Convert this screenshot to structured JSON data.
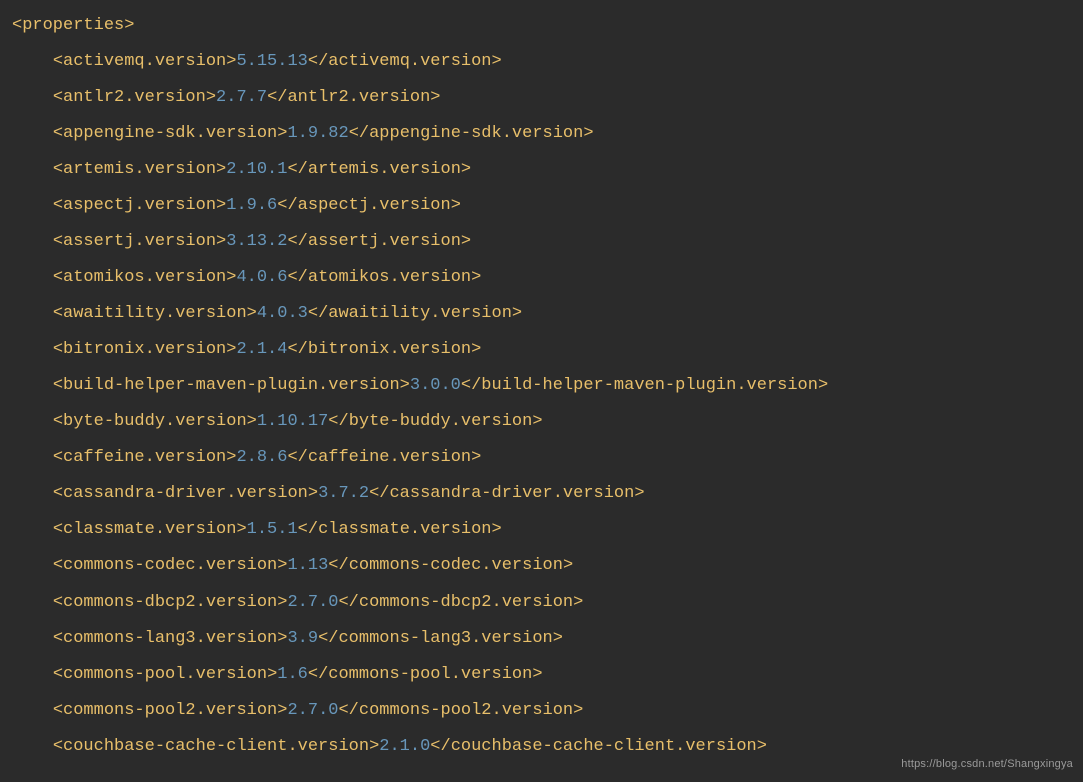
{
  "root_tag": "properties",
  "lines": [
    {
      "tag": "activemq.version",
      "value": "5.15.13"
    },
    {
      "tag": "antlr2.version",
      "value": "2.7.7"
    },
    {
      "tag": "appengine-sdk.version",
      "value": "1.9.82"
    },
    {
      "tag": "artemis.version",
      "value": "2.10.1"
    },
    {
      "tag": "aspectj.version",
      "value": "1.9.6"
    },
    {
      "tag": "assertj.version",
      "value": "3.13.2"
    },
    {
      "tag": "atomikos.version",
      "value": "4.0.6"
    },
    {
      "tag": "awaitility.version",
      "value": "4.0.3"
    },
    {
      "tag": "bitronix.version",
      "value": "2.1.4"
    },
    {
      "tag": "build-helper-maven-plugin.version",
      "value": "3.0.0"
    },
    {
      "tag": "byte-buddy.version",
      "value": "1.10.17"
    },
    {
      "tag": "caffeine.version",
      "value": "2.8.6"
    },
    {
      "tag": "cassandra-driver.version",
      "value": "3.7.2"
    },
    {
      "tag": "classmate.version",
      "value": "1.5.1"
    },
    {
      "tag": "commons-codec.version",
      "value": "1.13"
    },
    {
      "tag": "commons-dbcp2.version",
      "value": "2.7.0"
    },
    {
      "tag": "commons-lang3.version",
      "value": "3.9"
    },
    {
      "tag": "commons-pool.version",
      "value": "1.6"
    },
    {
      "tag": "commons-pool2.version",
      "value": "2.7.0"
    },
    {
      "tag": "couchbase-cache-client.version",
      "value": "2.1.0"
    }
  ],
  "watermark": "https://blog.csdn.net/Shangxingya"
}
